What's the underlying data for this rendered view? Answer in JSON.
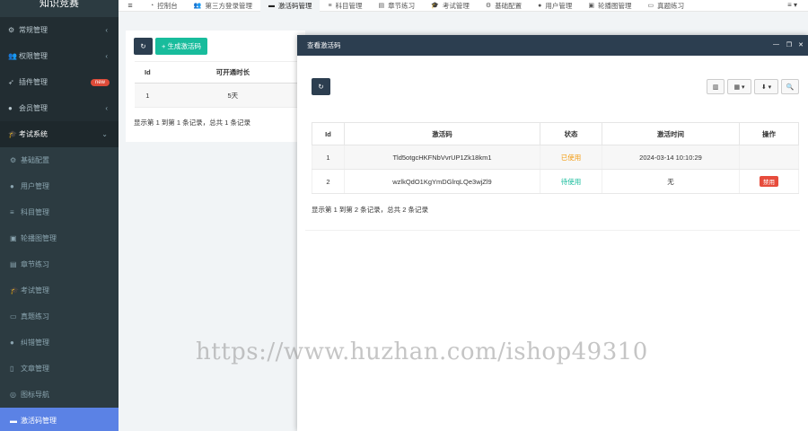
{
  "sidebar": {
    "logo": "知识竞赛",
    "items": [
      {
        "label": "常规管理",
        "icon": "gears-icon",
        "glyph": "⚙",
        "arrow": "‹"
      },
      {
        "label": "权限管理",
        "icon": "group-icon",
        "glyph": "👥",
        "arrow": "‹"
      },
      {
        "label": "插件管理",
        "icon": "rocket-icon",
        "glyph": "➶",
        "badge": "new"
      },
      {
        "label": "会员管理",
        "icon": "user-icon",
        "glyph": "●",
        "arrow": "‹"
      },
      {
        "label": "考试系统",
        "icon": "graduation-cap-icon",
        "glyph": "🎓",
        "arrow": "⌄"
      }
    ],
    "sub_items": [
      {
        "label": "基础配置",
        "icon": "cog-icon",
        "glyph": "⚙"
      },
      {
        "label": "用户管理",
        "icon": "user-icon",
        "glyph": "●"
      },
      {
        "label": "科目管理",
        "icon": "list-icon",
        "glyph": "≡"
      },
      {
        "label": "轮播图管理",
        "icon": "image-icon",
        "glyph": "▣"
      },
      {
        "label": "章节练习",
        "icon": "book-icon",
        "glyph": "▤"
      },
      {
        "label": "考试管理",
        "icon": "graduation-cap-icon",
        "glyph": "🎓"
      },
      {
        "label": "真题练习",
        "icon": "file-icon",
        "glyph": "▭"
      },
      {
        "label": "纠错管理",
        "icon": "info-icon",
        "glyph": "●"
      },
      {
        "label": "文章管理",
        "icon": "article-icon",
        "glyph": "▯"
      },
      {
        "label": "图标导航",
        "icon": "compass-icon",
        "glyph": "◎"
      },
      {
        "label": "激活码管理",
        "icon": "card-icon",
        "glyph": "▬"
      }
    ]
  },
  "topnav": {
    "menu_icon": "≡",
    "tabs": [
      {
        "label": "控制台",
        "icon": "dashboard-icon",
        "glyph": "◔"
      },
      {
        "label": "第三方登录管理",
        "icon": "users-icon",
        "glyph": "👥"
      },
      {
        "label": "激活码管理",
        "icon": "card-icon",
        "glyph": "▬"
      },
      {
        "label": "科目管理",
        "icon": "list-icon",
        "glyph": "≡"
      },
      {
        "label": "章节练习",
        "icon": "book-icon",
        "glyph": "▤"
      },
      {
        "label": "考试管理",
        "icon": "graduation-cap-icon",
        "glyph": "🎓"
      },
      {
        "label": "基础配置",
        "icon": "cog-icon",
        "glyph": "⚙"
      },
      {
        "label": "用户管理",
        "icon": "user-icon",
        "glyph": "●"
      },
      {
        "label": "轮播图管理",
        "icon": "image-icon",
        "glyph": "▣"
      },
      {
        "label": "真题练习",
        "icon": "file-icon",
        "glyph": "▭"
      }
    ],
    "right_menu": "≡ ▾"
  },
  "main": {
    "refresh_glyph": "↻",
    "generate_label": "+ 生成激活码",
    "columns": [
      "Id",
      "可开通时长"
    ],
    "rows": [
      [
        "1",
        "5天"
      ]
    ],
    "page_info": "显示第 1 到第 1 条记录，总共 1 条记录"
  },
  "modal": {
    "title": "查看激活码",
    "minimize": "—",
    "maximize": "❐",
    "close": "✕",
    "refresh_glyph": "↻",
    "toolbar": {
      "toggle": "▥",
      "columns": "▦ ▾",
      "export": "⬇ ▾",
      "search": "🔍"
    },
    "columns": [
      "Id",
      "激活码",
      "状态",
      "激活时间",
      "操作"
    ],
    "rows": [
      {
        "id": "1",
        "code": "Tld5otgcHKFNbVvrUP1Zk18km1",
        "status": "已使用",
        "time": "2024-03-14 10:10:29",
        "action": ""
      },
      {
        "id": "2",
        "code": "wzlkQdO1KgYmDGlrqLQe3wjZl9",
        "status": "待使用",
        "time": "无",
        "action": "禁用"
      }
    ],
    "page_info": "显示第 1 到第 2 条记录，总共 2 条记录"
  },
  "watermark": "https://www.huzhan.com/ishop49310"
}
